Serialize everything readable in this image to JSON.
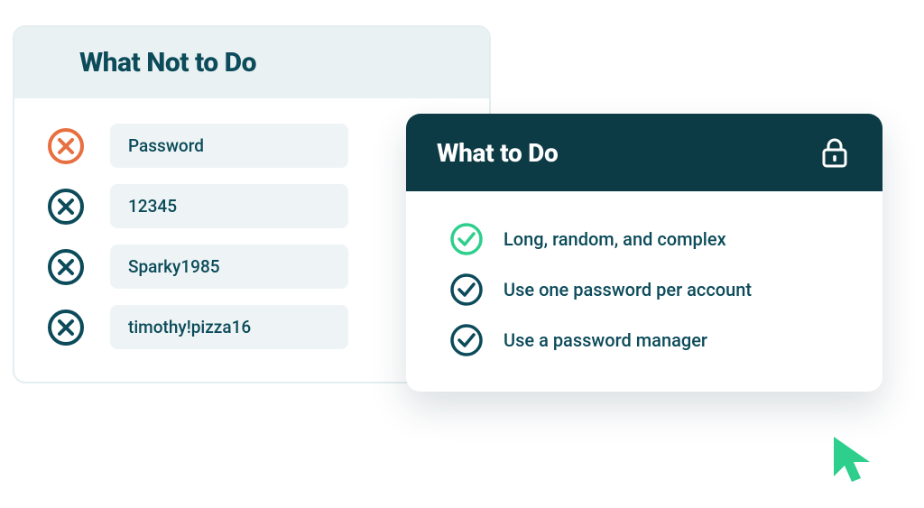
{
  "colors": {
    "teal_dark": "#0c4b5a",
    "teal_header": "#0d3b45",
    "pale_blue": "#e9f1f3",
    "pill_bg": "#eef4f5",
    "orange": "#e86f3f",
    "green": "#2ecf8c"
  },
  "left_card": {
    "title": "What Not to Do",
    "items": [
      {
        "label": "Password",
        "highlight": true
      },
      {
        "label": "12345",
        "highlight": false
      },
      {
        "label": "Sparky1985",
        "highlight": false
      },
      {
        "label": "timothy!pizza16",
        "highlight": false
      }
    ]
  },
  "right_card": {
    "title": "What to Do",
    "items": [
      {
        "label": "Long, random, and complex",
        "highlight": true
      },
      {
        "label": "Use one password per account",
        "highlight": false
      },
      {
        "label": "Use a password manager",
        "highlight": false
      }
    ]
  }
}
